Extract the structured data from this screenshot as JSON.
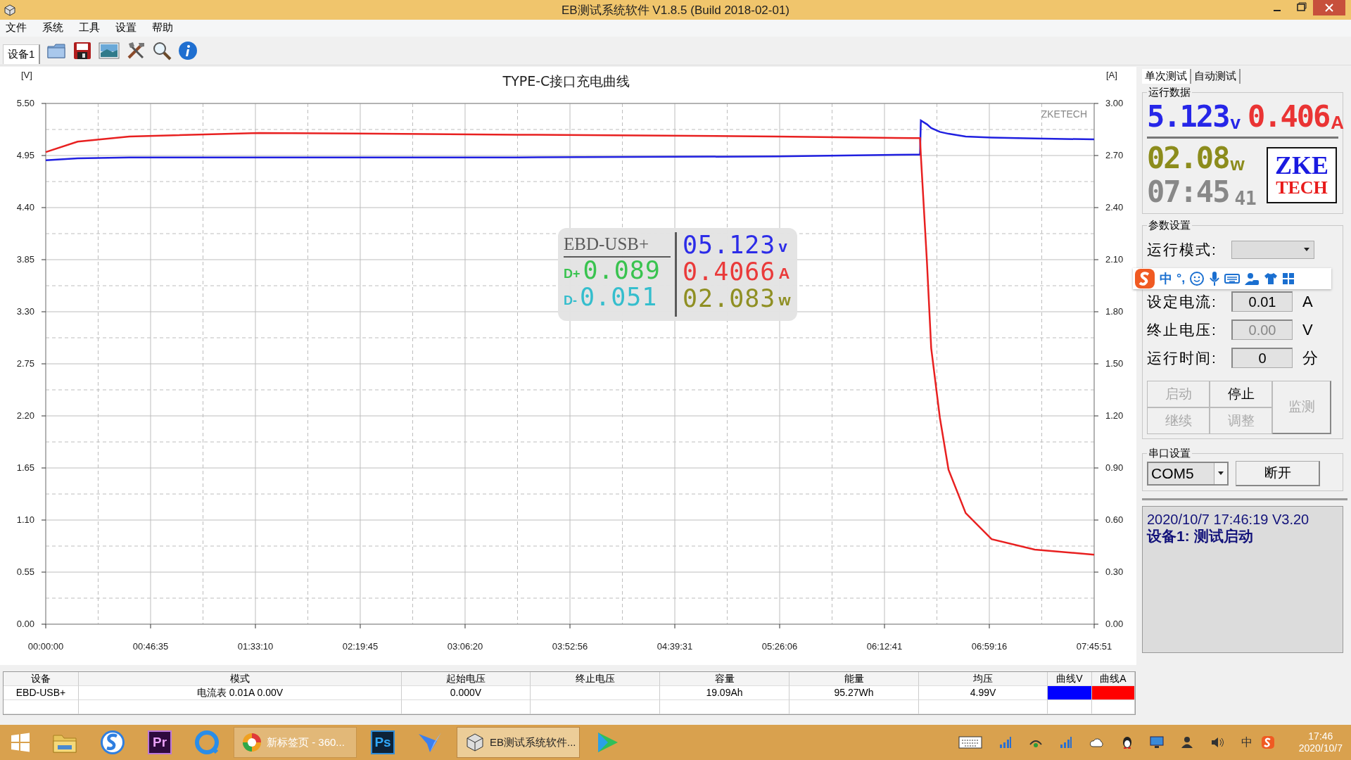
{
  "window": {
    "title": "EB测试系统软件 V1.8.5 (Build 2018-02-01)"
  },
  "menu": [
    "文件",
    "系统",
    "工具",
    "设置",
    "帮助"
  ],
  "device_tabs": [
    {
      "label": "设备1",
      "selected": true
    }
  ],
  "chart": {
    "corner_label": "ZKETECH",
    "chart_data": {
      "type": "line",
      "grid": true,
      "title": "TYPE-C接口充电曲线",
      "ylabel": "[V]",
      "y2label": "[A]",
      "x": [
        0,
        850,
        2230,
        5678,
        12573,
        19469,
        23147,
        23308,
        23331,
        23492,
        23607,
        23837,
        24067,
        24526,
        25216,
        26365,
        27951
      ],
      "xlim": [
        0,
        27951
      ],
      "xticks": [
        {
          "value": 0,
          "label": "00:00:00"
        },
        {
          "value": 2795,
          "label": "00:46:35"
        },
        {
          "value": 5590,
          "label": "01:33:10"
        },
        {
          "value": 8385,
          "label": "02:19:45"
        },
        {
          "value": 11180,
          "label": "03:06:20"
        },
        {
          "value": 13976,
          "label": "03:52:56"
        },
        {
          "value": 16771,
          "label": "04:39:31"
        },
        {
          "value": 19566,
          "label": "05:26:06"
        },
        {
          "value": 22361,
          "label": "06:12:41"
        },
        {
          "value": 25156,
          "label": "06:59:16"
        },
        {
          "value": 27951,
          "label": "07:45:51"
        }
      ],
      "ylim": [
        0,
        5.5
      ],
      "yticks": [
        {
          "value": 0,
          "label": "0.00"
        },
        {
          "value": 0.55,
          "label": "0.55"
        },
        {
          "value": 1.1,
          "label": "1.10"
        },
        {
          "value": 1.65,
          "label": "1.65"
        },
        {
          "value": 2.2,
          "label": "2.20"
        },
        {
          "value": 2.75,
          "label": "2.75"
        },
        {
          "value": 3.3,
          "label": "3.30"
        },
        {
          "value": 3.85,
          "label": "3.85"
        },
        {
          "value": 4.4,
          "label": "4.40"
        },
        {
          "value": 4.95,
          "label": "4.95"
        },
        {
          "value": 5.5,
          "label": "5.50"
        }
      ],
      "y2lim": [
        0,
        3
      ],
      "y2ticks": [
        {
          "value": 0,
          "label": "0.00"
        },
        {
          "value": 0.3,
          "label": "0.30"
        },
        {
          "value": 0.6,
          "label": "0.60"
        },
        {
          "value": 0.9,
          "label": "0.90"
        },
        {
          "value": 1.2,
          "label": "1.20"
        },
        {
          "value": 1.5,
          "label": "1.50"
        },
        {
          "value": 1.8,
          "label": "1.80"
        },
        {
          "value": 2.1,
          "label": "2.10"
        },
        {
          "value": 2.4,
          "label": "2.40"
        },
        {
          "value": 2.7,
          "label": "2.70"
        },
        {
          "value": 3,
          "label": "3.00"
        }
      ],
      "series": [
        {
          "color": "#2020e0",
          "values": [
            4.9,
            4.92,
            4.93,
            4.93,
            4.93,
            4.94,
            4.96,
            4.96,
            5.32,
            5.28,
            5.24,
            5.2,
            5.18,
            5.15,
            5.14,
            5.13,
            5.12
          ]
        },
        {
          "color": "#e82020",
          "axis": "y2",
          "values": [
            2.72,
            2.78,
            2.81,
            2.83,
            2.82,
            2.81,
            2.8,
            2.8,
            2.7,
            2.09,
            1.59,
            1.19,
            0.89,
            0.64,
            0.49,
            0.43,
            0.4
          ]
        }
      ]
    }
  },
  "meter_display": {
    "device": "EBD-USB+",
    "voltage": "05.123",
    "voltage_unit": "v",
    "d_plus_label": "D+",
    "d_plus": "0.089",
    "current": "0.4066",
    "current_unit": "A",
    "d_minus_label": "D-",
    "d_minus": "0.051",
    "power": "02.083",
    "power_unit": "w"
  },
  "side_tabs": [
    {
      "label": "单次测试",
      "selected": true
    },
    {
      "label": "自动测试",
      "selected": false
    }
  ],
  "run_data": {
    "title": "运行数据",
    "voltage": "5.123",
    "voltage_unit": "v",
    "current": "0.406",
    "current_unit": "A",
    "power": "02.08",
    "power_unit": "w",
    "time": "07:45",
    "seconds": "41",
    "logo_top": "ZKE",
    "logo_bottom": "TECH"
  },
  "params": {
    "title": "参数设置",
    "rows": [
      {
        "kind": "select",
        "label": "运行模式:"
      },
      {
        "kind": "input",
        "label": "设定电流:",
        "value": "0.01",
        "unit": "A",
        "disabled": false
      },
      {
        "kind": "input",
        "label": "终止电压:",
        "value": "0.00",
        "unit": "V",
        "disabled": true
      },
      {
        "kind": "input",
        "label": "运行时间:",
        "value": "0",
        "unit": "分",
        "disabled": false
      }
    ],
    "buttons": [
      {
        "label": "启动",
        "disabled": true
      },
      {
        "label": "停止",
        "disabled": false
      },
      {
        "label": "继续",
        "disabled": true
      },
      {
        "label": "调整",
        "disabled": true
      }
    ],
    "side_button": {
      "label": "监测",
      "disabled": true
    }
  },
  "ime_bar": {
    "items": [
      {
        "kind": "logo"
      },
      {
        "kind": "text",
        "label": "中"
      },
      {
        "kind": "text",
        "label": "°,"
      },
      {
        "kind": "smiley"
      },
      {
        "kind": "mic"
      },
      {
        "kind": "keyboard"
      },
      {
        "kind": "person"
      },
      {
        "kind": "shirt"
      },
      {
        "kind": "grid"
      }
    ]
  },
  "serial": {
    "title": "串口设置",
    "port": "COM5",
    "button": "断开"
  },
  "log": [
    "2020/10/7 17:46:19  V3.20",
    "设备1: 测试启动"
  ],
  "table": {
    "columns": [
      "设备",
      "模式",
      "起始电压",
      "终止电压",
      "容量",
      "能量",
      "均压",
      "曲线V",
      "曲线A"
    ],
    "rows": [
      {
        "device": "EBD-USB+",
        "mode": "电流表  0.01A  0.00V",
        "start_voltage": "0.000V",
        "capacity": "19.09Ah",
        "energy": "95.27Wh",
        "avg_voltage": "4.99V",
        "curve_v": {
          "color": "#0000ff"
        },
        "curve_a": {
          "color": "#ff0000"
        }
      }
    ]
  },
  "taskbar": {
    "apps": [
      {
        "kind": "start"
      },
      {
        "kind": "folder"
      },
      {
        "kind": "swirl"
      },
      {
        "kind": "tile",
        "label": "Pr",
        "color": "#2e0a3e"
      },
      {
        "kind": "ring"
      },
      {
        "kind": "window",
        "label": "新标签页 - 360...",
        "selected": false
      },
      {
        "kind": "tile",
        "label": "Ps",
        "color": "#0c2238"
      },
      {
        "kind": "bird"
      },
      {
        "kind": "window",
        "label": "EB测试系统软件...",
        "selected": true
      },
      {
        "kind": "play"
      }
    ],
    "tray": [
      {
        "kind": "keyboard"
      },
      {
        "kind": "signal"
      },
      {
        "kind": "network"
      },
      {
        "kind": "signal"
      },
      {
        "kind": "cloud"
      },
      {
        "kind": "penguin"
      },
      {
        "kind": "monitor"
      },
      {
        "kind": "person"
      },
      {
        "kind": "speaker"
      },
      {
        "kind": "text",
        "label": "中"
      },
      {
        "kind": "logo"
      }
    ],
    "time": "17:46",
    "date": "2020/10/7"
  }
}
